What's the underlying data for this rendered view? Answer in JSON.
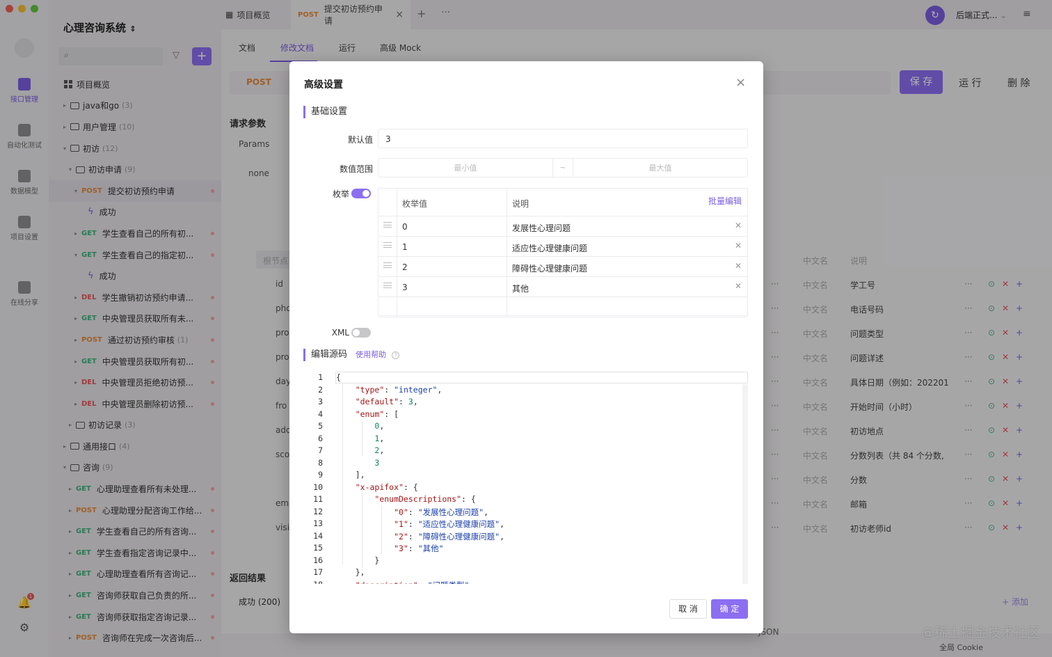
{
  "rail": {
    "items": [
      {
        "label": "接口管理",
        "active": true
      },
      {
        "label": "自动化测试",
        "active": false
      },
      {
        "label": "数据模型",
        "active": false
      },
      {
        "label": "项目设置",
        "active": false
      },
      {
        "label": "在线分享",
        "active": false
      }
    ],
    "notif_count": "1"
  },
  "sidebar": {
    "project_title": "心理咨询系统",
    "rows": [
      {
        "type": "overview",
        "indent": 22,
        "label": "项目概览"
      },
      {
        "type": "folder",
        "indent": 18,
        "label": "java和go",
        "count": "(3)",
        "caret": "▸"
      },
      {
        "type": "folder",
        "indent": 18,
        "label": "用户管理",
        "count": "(10)",
        "caret": "▸"
      },
      {
        "type": "folder",
        "indent": 18,
        "label": "初访",
        "count": "(12)",
        "caret": "▾"
      },
      {
        "type": "folder",
        "indent": 26,
        "label": "初访申请",
        "count": "(9)",
        "caret": "▾"
      },
      {
        "type": "api",
        "indent": 34,
        "method": "POST",
        "label": "提交初访预约申请",
        "caret": "▾",
        "selected": true
      },
      {
        "type": "case",
        "indent": 56,
        "label": "成功"
      },
      {
        "type": "api",
        "indent": 34,
        "method": "GET",
        "label": "学生查看自己的所有初...",
        "caret": "▸"
      },
      {
        "type": "api",
        "indent": 34,
        "method": "GET",
        "label": "学生查看自己的指定初...",
        "caret": "▾"
      },
      {
        "type": "case",
        "indent": 56,
        "label": "成功"
      },
      {
        "type": "api",
        "indent": 34,
        "method": "DEL",
        "label": "学生撤销初访预约申请...",
        "caret": "▸"
      },
      {
        "type": "api",
        "indent": 34,
        "method": "GET",
        "label": "中央管理员获取所有未...",
        "caret": "▸"
      },
      {
        "type": "api",
        "indent": 34,
        "method": "POST",
        "label": "通过初访预约审核",
        "count": "(1)",
        "caret": "▸"
      },
      {
        "type": "api",
        "indent": 34,
        "method": "GET",
        "label": "中央管理员获取所有初...",
        "caret": "▸"
      },
      {
        "type": "api",
        "indent": 34,
        "method": "DEL",
        "label": "中央管理员拒绝初访预...",
        "caret": "▸"
      },
      {
        "type": "api",
        "indent": 34,
        "method": "DEL",
        "label": "中央管理员删除初访预...",
        "caret": "▸"
      },
      {
        "type": "folder",
        "indent": 26,
        "label": "初访记录",
        "count": "(3)",
        "caret": "▸"
      },
      {
        "type": "folder",
        "indent": 18,
        "label": "通用接口",
        "count": "(4)",
        "caret": "▸"
      },
      {
        "type": "folder",
        "indent": 18,
        "label": "咨询",
        "count": "(9)",
        "caret": "▾"
      },
      {
        "type": "api",
        "indent": 26,
        "method": "GET",
        "label": "心理助理查看所有未处理...",
        "caret": "▸"
      },
      {
        "type": "api",
        "indent": 26,
        "method": "POST",
        "label": "心理助理分配咨询工作给...",
        "caret": "▸"
      },
      {
        "type": "api",
        "indent": 26,
        "method": "GET",
        "label": "学生查看自己的所有咨询...",
        "caret": "▸"
      },
      {
        "type": "api",
        "indent": 26,
        "method": "GET",
        "label": "学生查看指定咨询记录中...",
        "caret": "▸"
      },
      {
        "type": "api",
        "indent": 26,
        "method": "GET",
        "label": "心理助理查看所有咨询记...",
        "caret": "▸"
      },
      {
        "type": "api",
        "indent": 26,
        "method": "GET",
        "label": "咨询师获取自己负责的所...",
        "caret": "▸"
      },
      {
        "type": "api",
        "indent": 26,
        "method": "GET",
        "label": "咨询师获取指定咨询记录...",
        "caret": "▸"
      },
      {
        "type": "api",
        "indent": 26,
        "method": "POST",
        "label": "咨询师在完成一次咨询后...",
        "caret": "▸"
      }
    ]
  },
  "topbar": {
    "tab_overview": "项目概览",
    "tab_active_method": "POST",
    "tab_active_label": "提交初访预约申请",
    "env": "后端正式..."
  },
  "main": {
    "subtabs": [
      "文档",
      "修改文档",
      "运行",
      "高级 Mock"
    ],
    "method": "POST",
    "save": "保 存",
    "run": "运 行",
    "delete": "删 除",
    "req_params": "请求参数",
    "params_tab": "Params",
    "none_tab": "none",
    "root_placeholder": "根节点",
    "field_names": [
      "id",
      "pho",
      "pro",
      "pro",
      "day",
      "fro",
      "add",
      "sco",
      "",
      "em",
      "visi"
    ],
    "cn_placeholder": "中文名",
    "desc_placeholder": "说明",
    "descs": [
      "学工号",
      "电话号码",
      "问题类型",
      "问题详述",
      "具体日期（例如：202201",
      "开始时间（小时）",
      "初访地点",
      "分数列表（共 84 个分数,",
      "分数",
      "邮箱",
      "初访老师id"
    ],
    "return_title": "返回结果",
    "success": "成功 (200)",
    "add": "+ 添加",
    "json": "JSON",
    "cookie": "全局 Cookie",
    "watermark": "@稀土掘金技术社区"
  },
  "modal": {
    "title": "高级设置",
    "basic_section": "基础设置",
    "default_label": "默认值",
    "default_value": "3",
    "range_label": "数值范围",
    "min_placeholder": "最小值",
    "range_sep": "~",
    "max_placeholder": "最大值",
    "enum_label": "枚举",
    "enum_on": true,
    "enum_head_value": "枚举值",
    "enum_head_desc": "说明",
    "batch_edit": "批量编辑",
    "enums": [
      {
        "value": "0",
        "desc": "发展性心理问题"
      },
      {
        "value": "1",
        "desc": "适应性心理健康问题"
      },
      {
        "value": "2",
        "desc": "障碍性心理健康问题"
      },
      {
        "value": "3",
        "desc": "其他"
      }
    ],
    "xml_label": "XML",
    "xml_on": false,
    "source_section": "编辑源码",
    "help": "使用帮助",
    "code_lines": [
      "{",
      "    \"type\": \"integer\",",
      "    \"default\": 3,",
      "    \"enum\": [",
      "        0,",
      "        1,",
      "        2,",
      "        3",
      "    ],",
      "    \"x-apifox\": {",
      "        \"enumDescriptions\": {",
      "            \"0\": \"发展性心理问题\",",
      "            \"1\": \"适应性心理健康问题\",",
      "            \"2\": \"障碍性心理健康问题\",",
      "            \"3\": \"其他\"",
      "        }",
      "    },",
      "    \"description\": \"问题类型\""
    ],
    "cancel": "取 消",
    "confirm": "确 定"
  },
  "colors": {
    "accent": "#8b6ff0",
    "get": "#3db07c",
    "post": "#e5883a",
    "del": "#e45656"
  }
}
